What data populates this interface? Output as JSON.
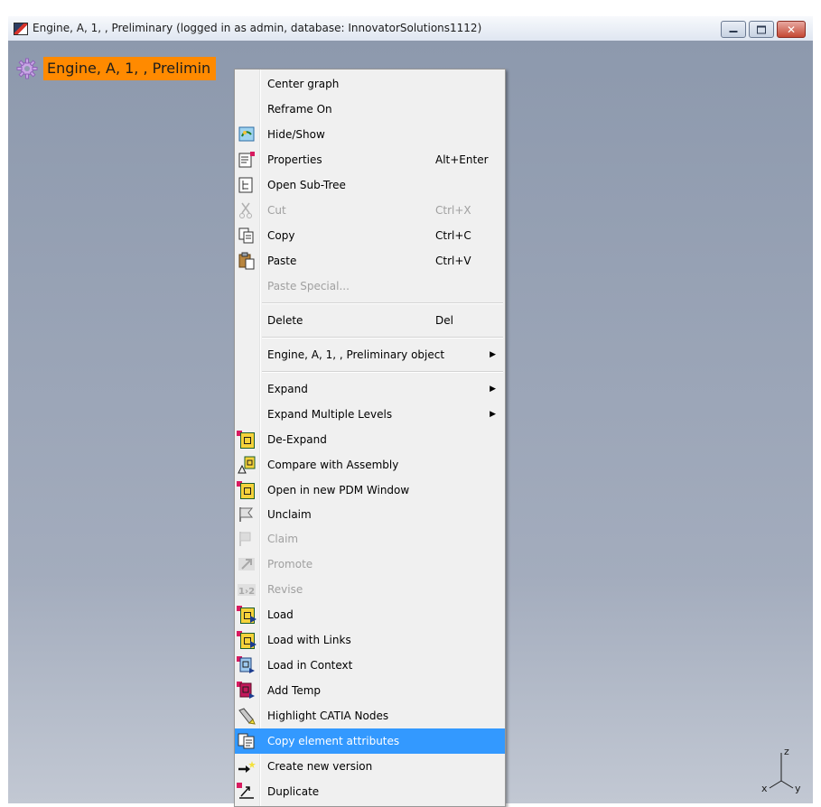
{
  "window": {
    "title": "Engine, A, 1, , Preliminary (logged in as admin, database: InnovatorSolutions1112)",
    "controls": {
      "minimize": "minimize",
      "maximize": "maximize",
      "close": "✕"
    }
  },
  "canvas": {
    "node_label": "Engine, A, 1, , Prelimin",
    "axes": {
      "z": "z",
      "x": "x",
      "y": "y"
    }
  },
  "menu": {
    "items": [
      {
        "id": "center-graph",
        "label": "Center graph",
        "shortcut": "",
        "icon": "none",
        "enabled": true
      },
      {
        "id": "reframe-on",
        "label": "Reframe On",
        "shortcut": "",
        "icon": "none",
        "enabled": true
      },
      {
        "id": "hide-show",
        "label": "Hide/Show",
        "shortcut": "",
        "icon": "hide-show-icon",
        "enabled": true
      },
      {
        "id": "properties",
        "label": "Properties",
        "shortcut": "Alt+Enter",
        "icon": "properties-icon",
        "enabled": true
      },
      {
        "id": "open-sub-tree",
        "label": "Open Sub-Tree",
        "shortcut": "",
        "icon": "tree-icon",
        "enabled": true
      },
      {
        "id": "cut",
        "label": "Cut",
        "shortcut": "Ctrl+X",
        "icon": "scissors-icon",
        "enabled": false
      },
      {
        "id": "copy",
        "label": "Copy",
        "shortcut": "Ctrl+C",
        "icon": "copy-icon",
        "enabled": true
      },
      {
        "id": "paste",
        "label": "Paste",
        "shortcut": "Ctrl+V",
        "icon": "paste-icon",
        "enabled": true
      },
      {
        "id": "paste-special",
        "label": "Paste Special...",
        "shortcut": "",
        "icon": "none",
        "enabled": false
      },
      {
        "id": "delete",
        "label": "Delete",
        "shortcut": "Del",
        "icon": "none",
        "enabled": true
      },
      {
        "id": "object-submenu",
        "label": "Engine, A, 1, , Preliminary object",
        "shortcut": "",
        "icon": "none",
        "enabled": true,
        "submenu": true
      },
      {
        "id": "expand",
        "label": "Expand",
        "shortcut": "",
        "icon": "none",
        "enabled": true,
        "submenu": true
      },
      {
        "id": "expand-multiple-levels",
        "label": "Expand Multiple Levels",
        "shortcut": "",
        "icon": "none",
        "enabled": true,
        "submenu": true
      },
      {
        "id": "de-expand",
        "label": "De-Expand",
        "shortcut": "",
        "icon": "de-expand-icon",
        "enabled": true
      },
      {
        "id": "compare-with-assembly",
        "label": "Compare with Assembly",
        "shortcut": "",
        "icon": "compare-icon",
        "enabled": true
      },
      {
        "id": "open-in-new-pdm-window",
        "label": "Open in new PDM Window",
        "shortcut": "",
        "icon": "pdm-window-icon",
        "enabled": true
      },
      {
        "id": "unclaim",
        "label": "Unclaim",
        "shortcut": "",
        "icon": "unclaim-flag-icon",
        "enabled": true
      },
      {
        "id": "claim",
        "label": "Claim",
        "shortcut": "",
        "icon": "claim-flag-icon",
        "enabled": false
      },
      {
        "id": "promote",
        "label": "Promote",
        "shortcut": "",
        "icon": "promote-arrow-icon",
        "enabled": false
      },
      {
        "id": "revise",
        "label": "Revise",
        "shortcut": "",
        "icon": "revise-icon",
        "enabled": false
      },
      {
        "id": "load",
        "label": "Load",
        "shortcut": "",
        "icon": "load-icon",
        "enabled": true
      },
      {
        "id": "load-with-links",
        "label": "Load with Links",
        "shortcut": "",
        "icon": "load-links-icon",
        "enabled": true
      },
      {
        "id": "load-in-context",
        "label": "Load in Context",
        "shortcut": "",
        "icon": "load-context-icon",
        "enabled": true
      },
      {
        "id": "add-temp",
        "label": "Add Temp",
        "shortcut": "",
        "icon": "add-temp-icon",
        "enabled": true
      },
      {
        "id": "highlight-catia-nodes",
        "label": "Highlight CATIA Nodes",
        "shortcut": "",
        "icon": "highlighter-icon",
        "enabled": true
      },
      {
        "id": "copy-element-attributes",
        "label": "Copy element attributes",
        "shortcut": "",
        "icon": "copy-attributes-icon",
        "enabled": true,
        "selected": true
      },
      {
        "id": "create-new-version",
        "label": "Create new version",
        "shortcut": "",
        "icon": "new-version-icon",
        "enabled": true
      },
      {
        "id": "duplicate",
        "label": "Duplicate",
        "shortcut": "",
        "icon": "duplicate-icon",
        "enabled": true
      }
    ]
  },
  "colors": {
    "selection": "#3399ff",
    "node_highlight": "#ff8a00",
    "canvas": "#8f9bb0"
  }
}
